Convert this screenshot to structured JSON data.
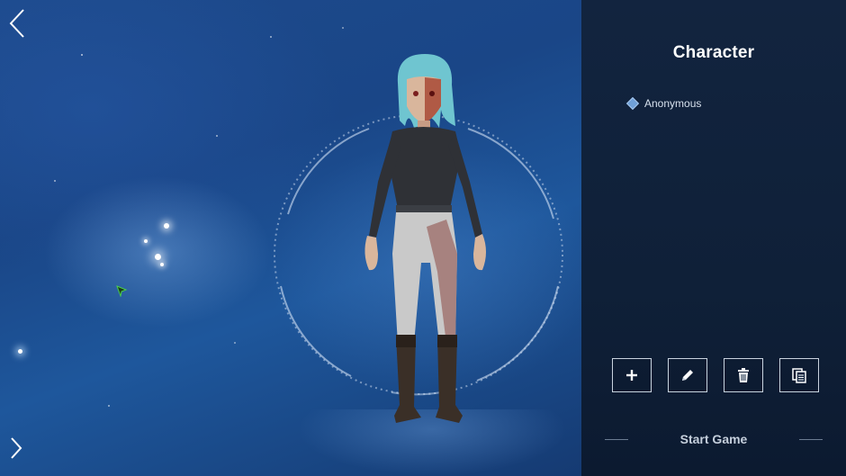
{
  "panel": {
    "title": "Character",
    "characters": [
      {
        "name": "Anonymous"
      }
    ],
    "actions": [
      {
        "name": "add-character-button",
        "icon": "plus-icon"
      },
      {
        "name": "edit-character-button",
        "icon": "pencil-icon"
      },
      {
        "name": "delete-character-button",
        "icon": "trash-icon"
      },
      {
        "name": "copy-character-button",
        "icon": "copy-icon"
      }
    ],
    "start_label": "Start Game"
  },
  "colors": {
    "accent": "#6fa0d8",
    "panel_bg": "#12243f",
    "scene_bg": "#1d4a8c",
    "button_border": "#c9d3df"
  }
}
